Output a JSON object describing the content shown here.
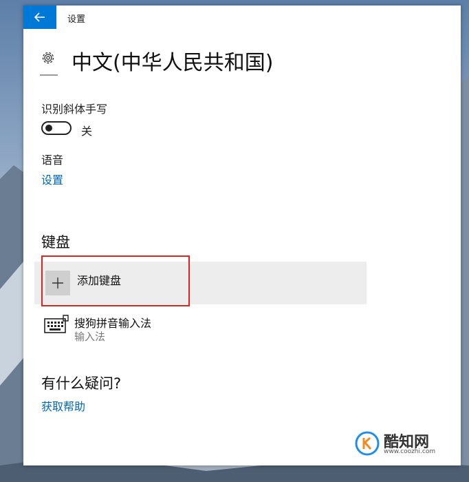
{
  "window": {
    "title": "设置"
  },
  "page": {
    "heading": "中文(中华人民共和国)"
  },
  "handwriting": {
    "label": "识别斜体手写",
    "toggle_state": "关",
    "enabled": false
  },
  "speech": {
    "label": "语音",
    "settings_link": "设置"
  },
  "keyboards": {
    "section_title": "键盘",
    "add_label": "添加键盘",
    "items": [
      {
        "name": "搜狗拼音输入法",
        "subtitle": "输入法"
      }
    ]
  },
  "help": {
    "title": "有什么疑问?",
    "link": "获取帮助"
  },
  "watermark": {
    "text": "酷知网",
    "url": "www.coozhi.com"
  },
  "colors": {
    "accent": "#0078d7",
    "link": "#0067b8",
    "highlight": "#e0201c"
  },
  "icons": {
    "back": "arrow-left-icon",
    "gear": "gear-icon",
    "plus": "plus-icon",
    "keyboard": "keyboard-icon"
  }
}
